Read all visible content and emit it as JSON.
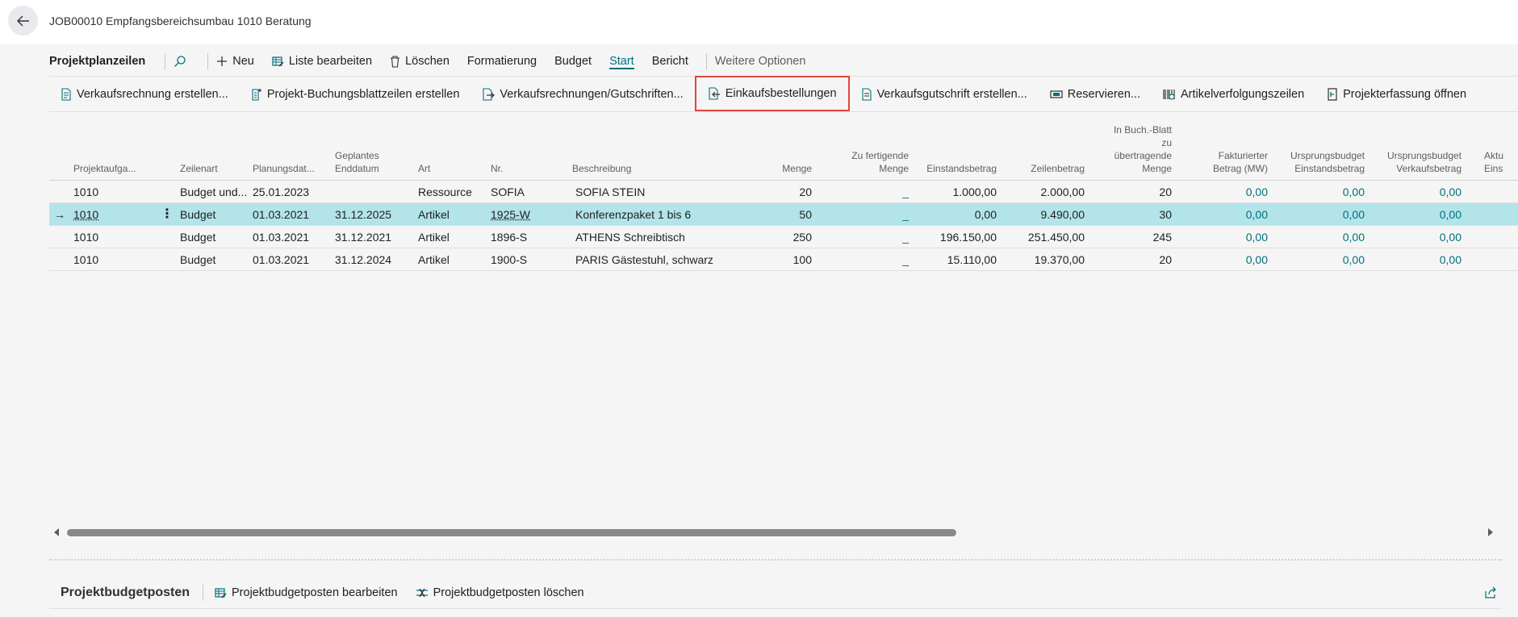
{
  "window": {
    "title": "JOB00010 Empfangsbereichsumbau 1010 Beratung"
  },
  "commandbar": {
    "title": "Projektplanzeilen",
    "new_label": "Neu",
    "edit_list_label": "Liste bearbeiten",
    "delete_label": "Löschen",
    "format_label": "Formatierung",
    "budget_label": "Budget",
    "start_label": "Start",
    "report_label": "Bericht",
    "more_label": "Weitere Optionen"
  },
  "actions": [
    {
      "label": "Verkaufsrechnung erstellen...",
      "icon": "invoice-icon"
    },
    {
      "label": "Projekt-Buchungsblattzeilen erstellen",
      "icon": "journal-add-icon"
    },
    {
      "label": "Verkaufsrechnungen/Gutschriften...",
      "icon": "invoice-arrow-icon"
    },
    {
      "label": "Einkaufsbestellungen",
      "icon": "purchase-order-icon",
      "highlighted": true
    },
    {
      "label": "Verkaufsgutschrift erstellen...",
      "icon": "credit-memo-icon"
    },
    {
      "label": "Reservieren...",
      "icon": "reserve-icon"
    },
    {
      "label": "Artikelverfolgungszeilen",
      "icon": "tracking-icon"
    },
    {
      "label": "Projekterfassung öffnen",
      "icon": "open-journal-icon"
    }
  ],
  "table": {
    "headers": {
      "task": "Projektaufga...",
      "line_type": "Zeilenart",
      "planning_date": "Planungsdat...",
      "end_date": "Geplantes\nEnddatum",
      "type": "Art",
      "no": "Nr.",
      "description": "Beschreibung",
      "quantity": "Menge",
      "qty_to_assemble": "Zu fertigende\nMenge",
      "unit_cost": "Einstandsbetrag",
      "line_amount": "Zeilenbetrag",
      "qty_to_transfer": "In Buch.-Blatt\nzu\nübertragende\nMenge",
      "invoiced_amount": "Fakturierter\nBetrag (MW)",
      "orig_budget_cost": "Ursprungsbudget\nEinstandsbetrag",
      "orig_budget_sales": "Ursprungsbudget\nVerkaufsbetrag",
      "actual_cost": "Aktu\nEins"
    },
    "rows": [
      {
        "task": "1010",
        "line_type": "Budget und...",
        "planning_date": "25.01.2023",
        "end_date": "",
        "type": "Ressource",
        "no": "SOFIA",
        "description": "SOFIA STEIN",
        "quantity": "20",
        "qty_to_assemble": "_",
        "unit_cost": "1.000,00",
        "line_amount": "2.000,00",
        "qty_to_transfer": "20",
        "invoiced_amount": "0,00",
        "orig_budget_cost": "0,00",
        "orig_budget_sales": "0,00"
      },
      {
        "task": "1010",
        "line_type": "Budget",
        "planning_date": "01.03.2021",
        "end_date": "31.12.2025",
        "type": "Artikel",
        "no": "1925-W",
        "description": "Konferenzpaket 1 bis 6",
        "quantity": "50",
        "qty_to_assemble": "_",
        "unit_cost": "0,00",
        "line_amount": "9.490,00",
        "qty_to_transfer": "30",
        "invoiced_amount": "0,00",
        "orig_budget_cost": "0,00",
        "orig_budget_sales": "0,00",
        "selected": true
      },
      {
        "task": "1010",
        "line_type": "Budget",
        "planning_date": "01.03.2021",
        "end_date": "31.12.2021",
        "type": "Artikel",
        "no": "1896-S",
        "description": "ATHENS Schreibtisch",
        "quantity": "250",
        "qty_to_assemble": "_",
        "unit_cost": "196.150,00",
        "line_amount": "251.450,00",
        "qty_to_transfer": "245",
        "invoiced_amount": "0,00",
        "orig_budget_cost": "0,00",
        "orig_budget_sales": "0,00"
      },
      {
        "task": "1010",
        "line_type": "Budget",
        "planning_date": "01.03.2021",
        "end_date": "31.12.2024",
        "type": "Artikel",
        "no": "1900-S",
        "description": "PARIS Gästestuhl, schwarz",
        "quantity": "100",
        "qty_to_assemble": "_",
        "unit_cost": "15.110,00",
        "line_amount": "19.370,00",
        "qty_to_transfer": "20",
        "invoiced_amount": "0,00",
        "orig_budget_cost": "0,00",
        "orig_budget_sales": "0,00"
      }
    ]
  },
  "footer": {
    "title": "Projektbudgetposten",
    "edit_label": "Projektbudgetposten bearbeiten",
    "delete_label": "Projektbudgetposten löschen"
  },
  "colors": {
    "accent": "#00707a",
    "selected_row": "#b2e4ea",
    "highlight_border": "#e2463a"
  }
}
